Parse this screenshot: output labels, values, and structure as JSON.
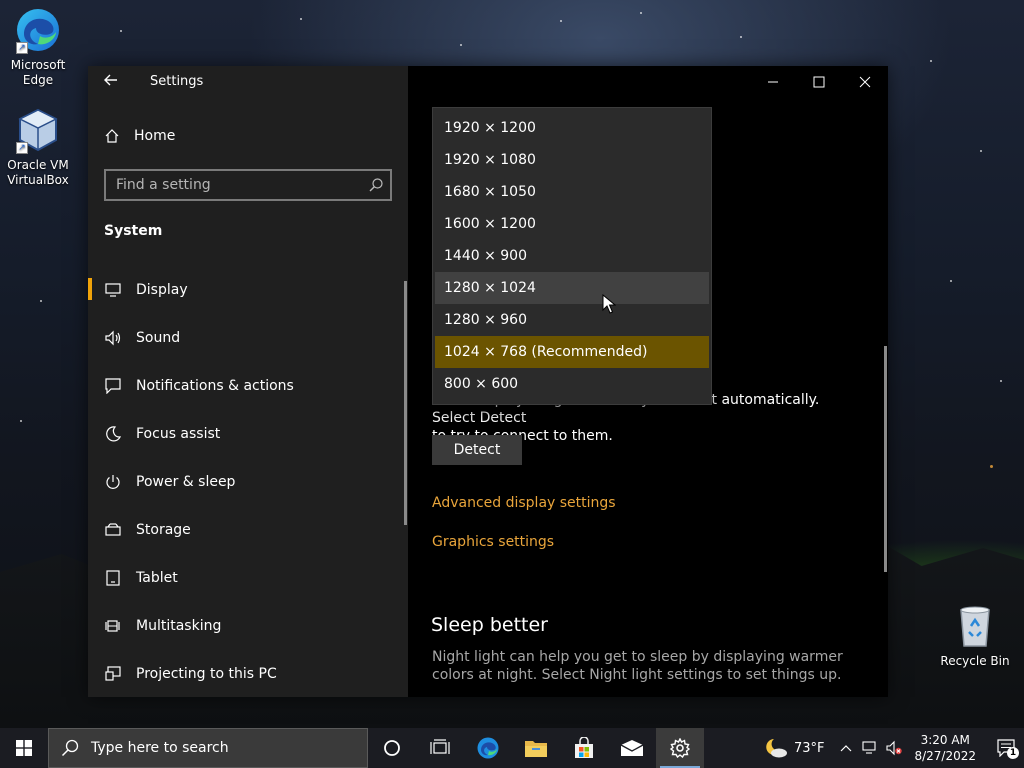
{
  "desktop": {
    "icons": [
      {
        "label": "Microsoft Edge",
        "icon": "edge-icon"
      },
      {
        "label": "Oracle VM VirtualBox",
        "icon": "virtualbox-icon"
      },
      {
        "label": "Recycle Bin",
        "icon": "recycle-bin-icon"
      }
    ]
  },
  "window": {
    "title": "Settings",
    "home_label": "Home",
    "search_placeholder": "Find a setting",
    "section_title": "System",
    "nav": [
      {
        "label": "Display",
        "icon": "display-icon",
        "active": true
      },
      {
        "label": "Sound",
        "icon": "sound-icon"
      },
      {
        "label": "Notifications & actions",
        "icon": "notifications-icon"
      },
      {
        "label": "Focus assist",
        "icon": "focus-assist-icon"
      },
      {
        "label": "Power & sleep",
        "icon": "power-icon"
      },
      {
        "label": "Storage",
        "icon": "storage-icon"
      },
      {
        "label": "Tablet",
        "icon": "tablet-icon"
      },
      {
        "label": "Multitasking",
        "icon": "multitasking-icon"
      },
      {
        "label": "Projecting to this PC",
        "icon": "projecting-icon"
      }
    ]
  },
  "content": {
    "detect_text_line1": "Older displays might not always connect automatically. Select Detect",
    "detect_text_line2": "to try to connect to them.",
    "detect_button": "Detect",
    "advanced_link": "Advanced display settings",
    "graphics_link": "Graphics settings",
    "sleep_title": "Sleep better",
    "sleep_text": "Night light can help you get to sleep by displaying warmer colors at night. Select Night light settings to set things up."
  },
  "dropdown": {
    "options": [
      "1920 × 1200",
      "1920 × 1080",
      "1680 × 1050",
      "1600 × 1200",
      "1440 × 900",
      "1280 × 1024",
      "1280 × 960",
      "1024 × 768 (Recommended)",
      "800 × 600"
    ],
    "hovered": "1280 × 1024",
    "selected": "1024 × 768 (Recommended)"
  },
  "taskbar": {
    "search_placeholder": "Type here to search",
    "weather": "73°F",
    "time": "3:20 AM",
    "date": "8/27/2022",
    "notification_count": "1"
  },
  "colors": {
    "accent": "#f0a30a",
    "link": "#e9a53b",
    "selected_option": "#6b5400"
  }
}
